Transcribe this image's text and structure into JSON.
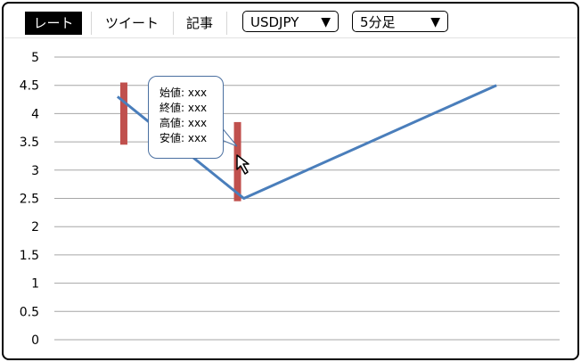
{
  "tabs": [
    {
      "label": "レート",
      "active": true
    },
    {
      "label": "ツイート",
      "active": false
    },
    {
      "label": "記事",
      "active": false
    }
  ],
  "pair_select": {
    "value": "USDJPY",
    "caret": "▼"
  },
  "interval_select": {
    "value": "5分足",
    "caret": "▼"
  },
  "tooltip": {
    "open": "始値: xxx",
    "close": "終値: xxx",
    "high": "高値: xxx",
    "low": "安値: xxx"
  },
  "colors": {
    "line": "#4a7ebb",
    "candle": "#c0504d",
    "grid": "#a6a6a6"
  },
  "chart_data": {
    "type": "line",
    "ylim": [
      0,
      5
    ],
    "yticks": [
      "0",
      "0.5",
      "1",
      "1.5",
      "2",
      "2.5",
      "3",
      "3.5",
      "4",
      "4.5",
      "5"
    ],
    "grid": true,
    "series": [
      {
        "points": [
          [
            1,
            4.3
          ],
          [
            2,
            3.4
          ],
          [
            3,
            2.5
          ],
          [
            7,
            4.5
          ]
        ]
      }
    ],
    "candles": [
      {
        "x": 1.1,
        "low": 3.45,
        "high": 4.55
      },
      {
        "x": 2.9,
        "low": 2.45,
        "high": 3.85
      }
    ],
    "xlim": [
      0,
      8
    ]
  }
}
